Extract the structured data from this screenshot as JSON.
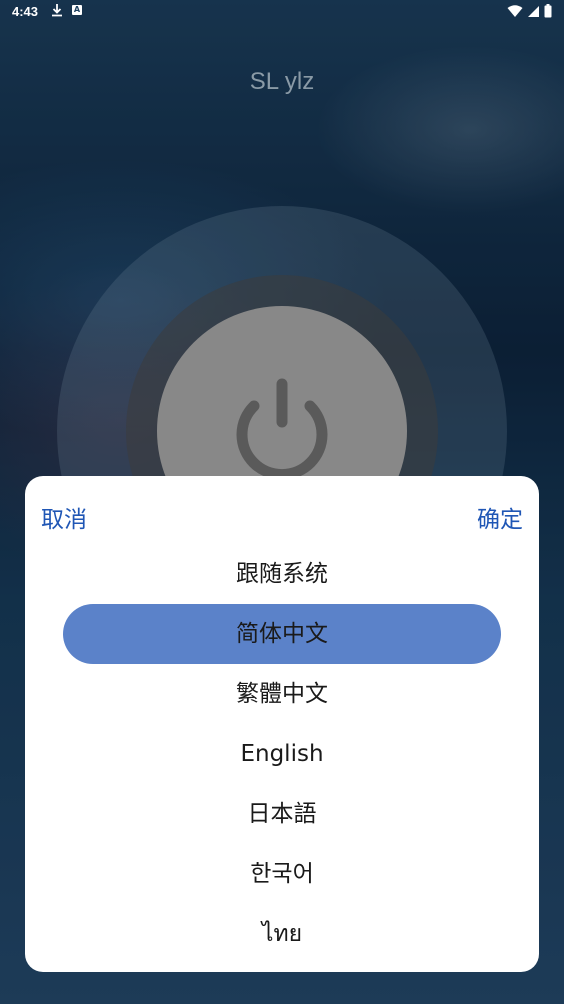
{
  "status_bar": {
    "time": "4:43",
    "badge": "A"
  },
  "app": {
    "title": "SL ylz"
  },
  "dialog": {
    "cancel_label": "取消",
    "confirm_label": "确定",
    "options": [
      {
        "label": "跟随系统",
        "selected": false
      },
      {
        "label": "简体中文",
        "selected": true
      },
      {
        "label": "繁體中文",
        "selected": false
      },
      {
        "label": "English",
        "selected": false
      },
      {
        "label": "日本語",
        "selected": false
      },
      {
        "label": "한국어",
        "selected": false
      },
      {
        "label": "ไทย",
        "selected": false
      }
    ]
  },
  "colors": {
    "accent": "#1f56b5",
    "selection": "#5b82c9",
    "power_button": "#888888"
  },
  "icons": [
    "download-icon",
    "app-badge-icon",
    "wifi-icon",
    "signal-icon",
    "battery-icon",
    "power-icon"
  ]
}
